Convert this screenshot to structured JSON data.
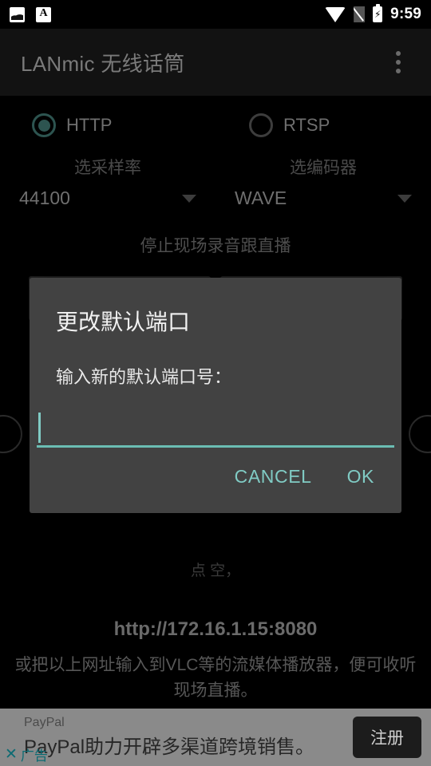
{
  "status_bar": {
    "time": "9:59",
    "icons": [
      "image-icon",
      "translate-a-icon",
      "wifi-icon",
      "no-sim-icon",
      "battery-charging-icon"
    ]
  },
  "app_bar": {
    "title": "LANmic 无线话筒",
    "overflow_label": "more-options"
  },
  "main": {
    "protocol_options": [
      {
        "label": "HTTP",
        "selected": true
      },
      {
        "label": "RTSP",
        "selected": false
      }
    ],
    "spinners": [
      {
        "hint": "选采样率",
        "value": "44100"
      },
      {
        "hint": "选编码器",
        "value": "WAVE"
      }
    ],
    "stop_text": "停止现场录音跟直播",
    "buttons": [
      {
        "label": ""
      },
      {
        "label": ""
      }
    ],
    "note_text": "点                                                      空，",
    "url": "http://172.16.1.15:8080",
    "description": "或把以上网址输入到VLC等的流媒体播放器，便可收听现场直播。"
  },
  "dialog": {
    "title": "更改默认端口",
    "message": "输入新的默认端口号：",
    "input_value": "",
    "input_placeholder": "",
    "cancel_label": "CANCEL",
    "ok_label": "OK"
  },
  "ad": {
    "brand": "PayPal",
    "headline": "PayPal助力开辟多渠道跨境销售。",
    "cta_label": "注册",
    "close_label": "广告"
  },
  "colors": {
    "accent_teal": "#80cbc4",
    "dialog_bg": "#424242",
    "app_bar_bg": "#121212",
    "page_bg": "#000000",
    "ad_bg": "#8a8a8a"
  }
}
